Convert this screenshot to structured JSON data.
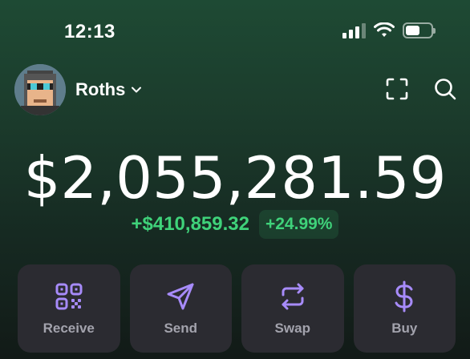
{
  "status_bar": {
    "time": "12:13",
    "battery_level": 0.55
  },
  "header": {
    "account_name": "Roths",
    "icons": [
      "chevron-down-icon",
      "scan-icon",
      "search-icon"
    ]
  },
  "portfolio": {
    "balance": "$2,055,281.59",
    "change_value": "+$410,859.32",
    "change_percent": "+24.99%"
  },
  "actions": [
    {
      "label": "Receive",
      "icon": "qr-code-icon"
    },
    {
      "label": "Send",
      "icon": "send-icon"
    },
    {
      "label": "Swap",
      "icon": "swap-icon"
    },
    {
      "label": "Buy",
      "icon": "dollar-icon"
    }
  ],
  "colors": {
    "accent": "#a78bfa",
    "positive": "#3fd27a",
    "action_bg": "#2b2b31",
    "action_label": "#a3a3ad"
  }
}
